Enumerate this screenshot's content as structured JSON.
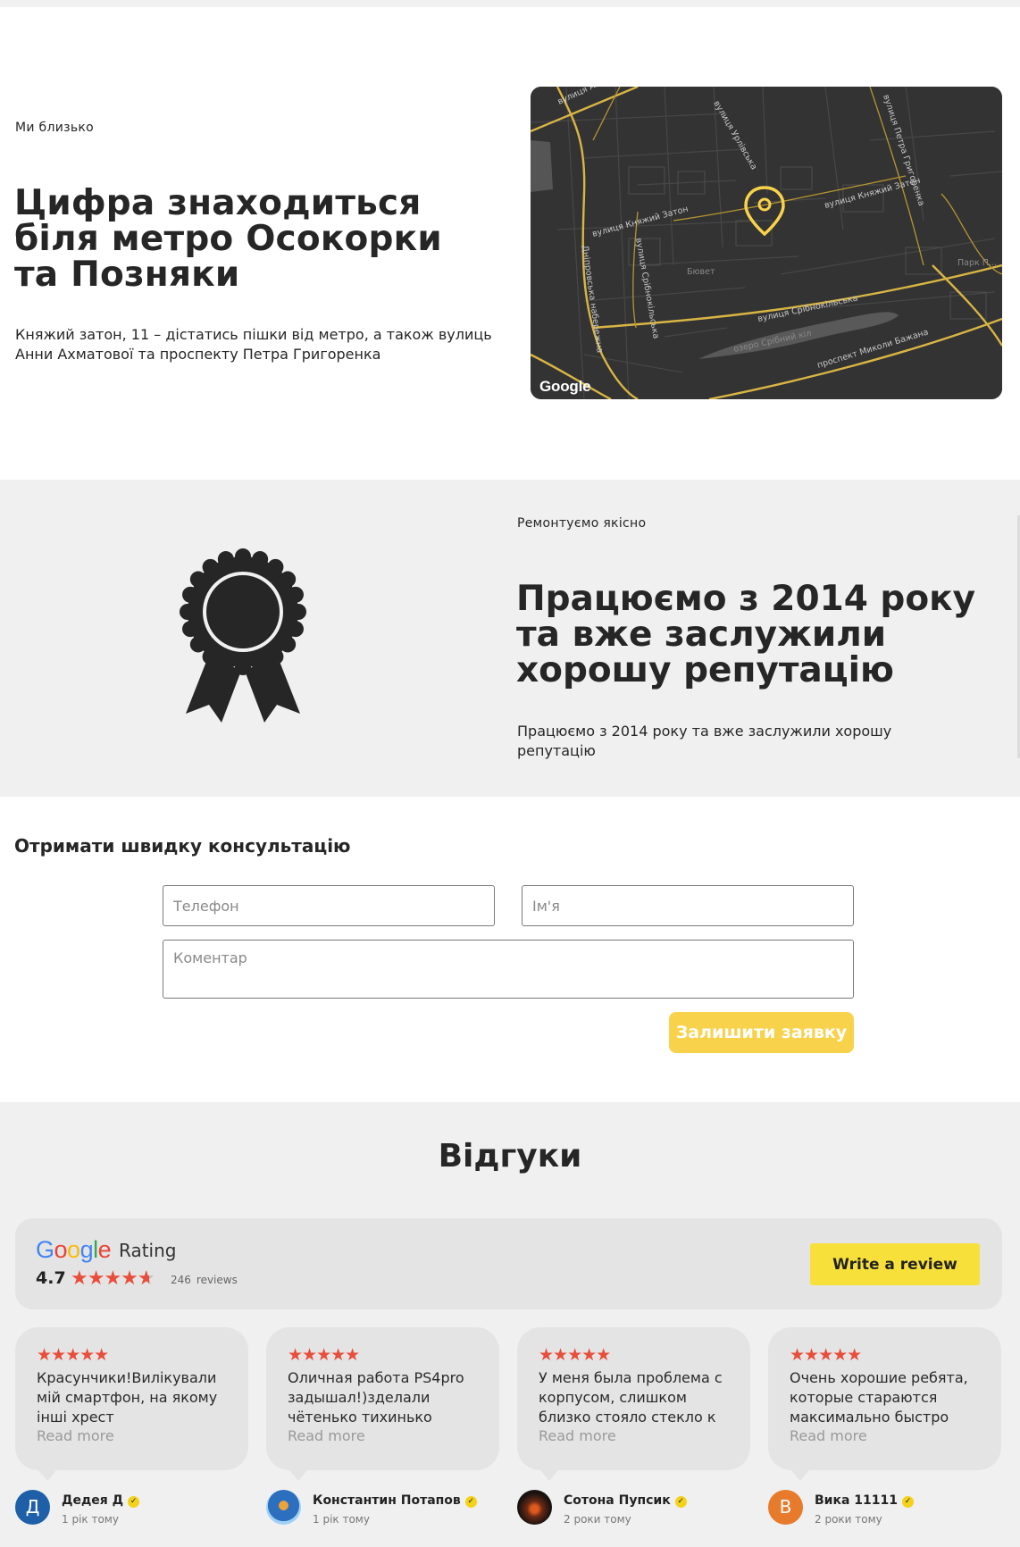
{
  "location": {
    "eyebrow": "Ми близько",
    "title": "Цифра знаходиться біля метро Осокорки та Позняки",
    "text": "Княжий затон, 11 – дістатись пішки від метро, а також вулиць Анни Ахматової та проспекту Петра Григоренка",
    "map": {
      "labels": [
        "вулиця Анни А...",
        "вулиця Урлівська",
        "вулиця Петра Григоренка",
        "вулиця Княжий Затон",
        "вулиця Княжий Затон",
        "вулиця Срібнокільська",
        "Дніпровська набережна",
        "вулиця Срібнокільська",
        "Бювет",
        "Парк П...",
        "озеро Срібний кіл",
        "проспект Миколи Бажана"
      ],
      "watermark": "Google",
      "pin_icon": "location-pin-icon",
      "pin_color": "#f7d24a"
    }
  },
  "reputation": {
    "eyebrow": "Ремонтуємо якісно",
    "title": "Працюємо з 2014 року та вже заслужили хорошу репутацію",
    "text": "Працюємо з 2014 року та вже заслужили хорошу репутацію",
    "badge_icon": "award-rosette-icon"
  },
  "form": {
    "title": "Отримати швидку консультацію",
    "phone_placeholder": "Телефон",
    "name_placeholder": "Ім'я",
    "comment_placeholder": "Коментар",
    "submit_label": "Залишити заявку",
    "accent_color": "#f7d24a"
  },
  "reviews": {
    "heading": "Відгуки",
    "summary": {
      "rating_label": "Rating",
      "rating_value": "4.7",
      "rating_stars": 4.7,
      "review_count": "246",
      "review_word": "reviews",
      "write_label": "Write a review",
      "star_color": "#e94d3b"
    },
    "cards": [
      {
        "stars": 5,
        "text": "Красунчики!Вилікували мій смартфон, на якому інші хрест",
        "more": "Read more",
        "author": "Дедея Д",
        "time": "1 рік тому",
        "avatar_letter": "Д",
        "avatar_color": "#1f5fa8"
      },
      {
        "stars": 5,
        "text": "Оличная работа PS4pro задышал!)зделали чётенько тихинько",
        "more": "Read more",
        "author": "Константин Потапов",
        "time": "1 рік тому",
        "avatar_letter": "",
        "avatar_color": "#3a8fd6"
      },
      {
        "stars": 5,
        "text": "У меня была проблема с корпусом, слишком близко стояло стекло к",
        "more": "Read more",
        "author": "Сотона Пупсик",
        "time": "2 роки тому",
        "avatar_letter": "",
        "avatar_color": "#2a1b16"
      },
      {
        "stars": 5,
        "text": "Очень хорошие ребята, которые стараются максимально быстро",
        "more": "Read more",
        "author": "Вика 11111",
        "time": "2 роки тому",
        "avatar_letter": "В",
        "avatar_color": "#e87a2c"
      }
    ]
  }
}
